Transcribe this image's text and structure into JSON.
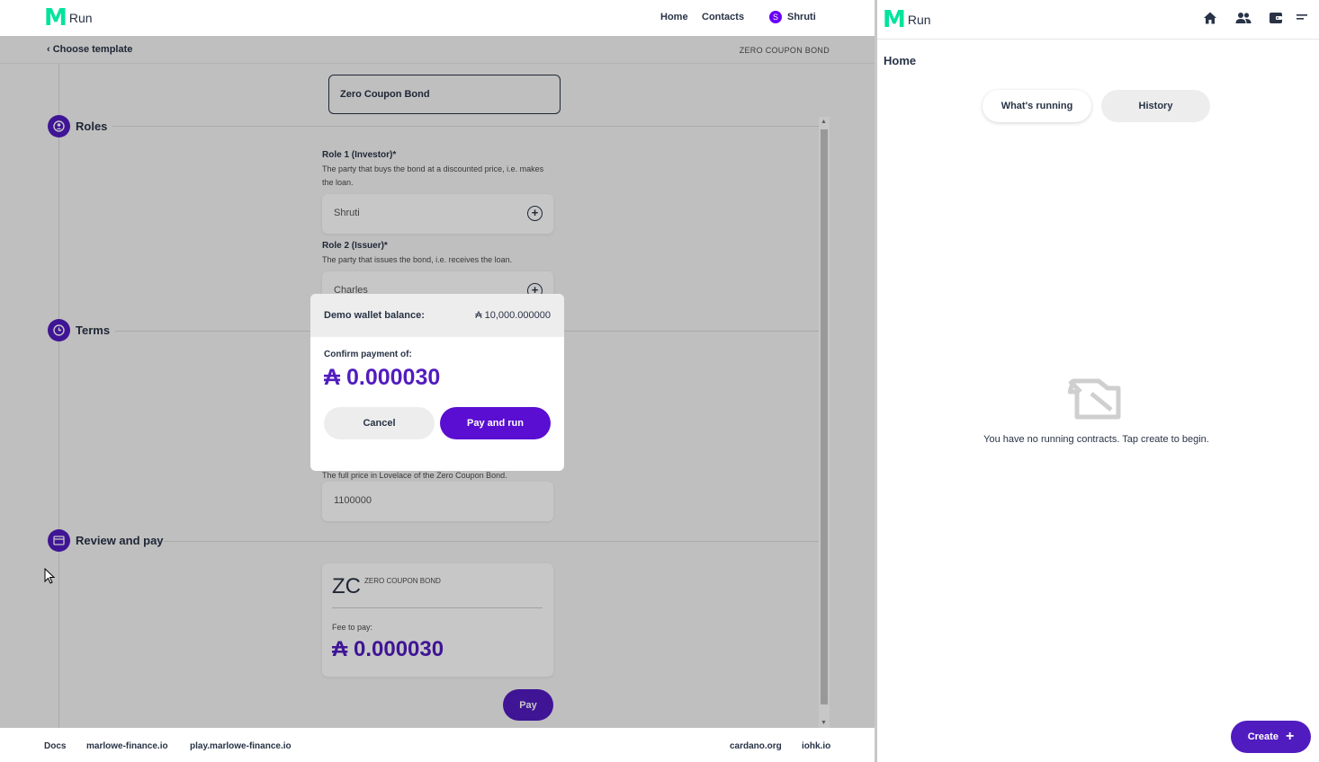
{
  "left": {
    "app_name": "Run",
    "nav": {
      "home": "Home",
      "contacts": "Contacts"
    },
    "user": {
      "initial": "S",
      "name": "Shruti"
    },
    "breadcrumb": {
      "back": "Choose template",
      "template": "ZERO COUPON BOND"
    },
    "contract_name": "Zero Coupon Bond",
    "sections": {
      "roles": "Roles",
      "terms": "Terms",
      "review": "Review and pay"
    },
    "roles": [
      {
        "label": "Role 1 (Investor)*",
        "description": "The party that buys the bond at a discounted price, i.e. makes the loan.",
        "value": "Shruti"
      },
      {
        "label": "Role 2 (Issuer)*",
        "description": "The party that issues the bond, i.e. receives the loan.",
        "value": "Charles"
      }
    ],
    "terms": {
      "price_description": "The full price in Lovelace of the Zero Coupon Bond.",
      "price_value": "1100000"
    },
    "summary": {
      "abbr": "ZC",
      "type": "ZERO COUPON BOND",
      "fee_label": "Fee to pay:",
      "fee_amount": "₳ 0.000030"
    },
    "pay_label": "Pay",
    "modal": {
      "balance_label": "Demo wallet balance:",
      "balance_value": "₳ 10,000.000000",
      "confirm_label": "Confirm payment of:",
      "confirm_amount": "₳ 0.000030",
      "cancel": "Cancel",
      "pay_and_run": "Pay and run"
    },
    "footer": {
      "docs": "Docs",
      "marlowe": "marlowe-finance.io",
      "play": "play.marlowe-finance.io",
      "cardano": "cardano.org",
      "iohk": "iohk.io"
    }
  },
  "right": {
    "app_name": "Run",
    "icons": [
      "home-icon",
      "contacts-icon",
      "wallet-icon",
      "menu-icon"
    ],
    "page_title": "Home",
    "tabs": {
      "running": "What's running",
      "history": "History"
    },
    "empty_message": "You have no running contracts. Tap create to begin.",
    "create_label": "Create"
  },
  "colors": {
    "primary": "#511cbf",
    "logo_green": "#00e39c",
    "text": "#283346"
  }
}
